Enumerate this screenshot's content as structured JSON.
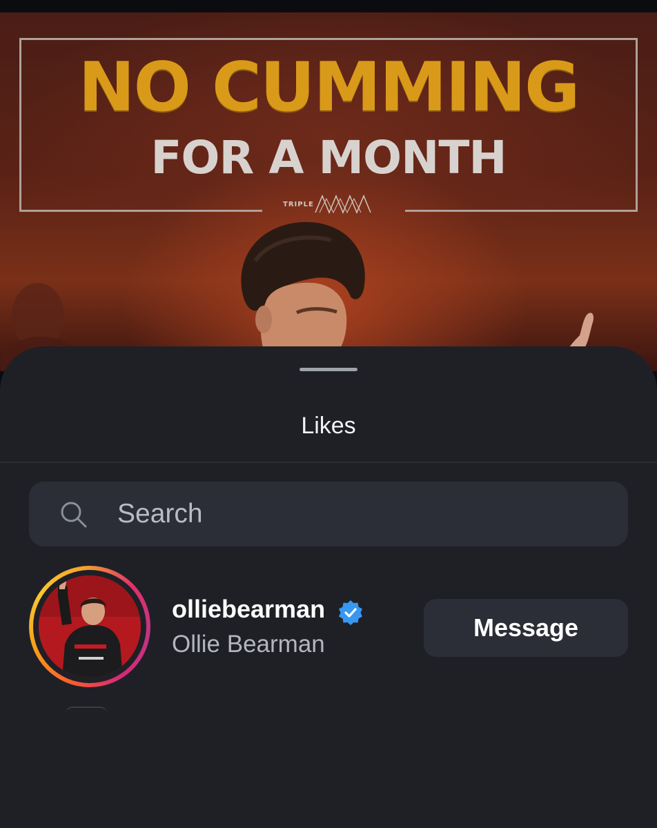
{
  "post": {
    "headline": "NO CUMMING",
    "subheadline": "FOR A MONTH",
    "brand": "TRIPLE"
  },
  "sheet": {
    "title": "Likes",
    "search": {
      "placeholder": "Search",
      "value": ""
    },
    "users": [
      {
        "username": "olliebearman",
        "full_name": "Ollie Bearman",
        "verified": true,
        "has_story": true,
        "action_label": "Message"
      }
    ]
  },
  "colors": {
    "sheet_bg": "#1f2026",
    "field_bg": "#2b2e36",
    "verified_blue": "#3897f0",
    "headline_gold": "#d99a1a"
  },
  "icons": {
    "search": "search-icon",
    "verified": "verified-badge-icon"
  }
}
